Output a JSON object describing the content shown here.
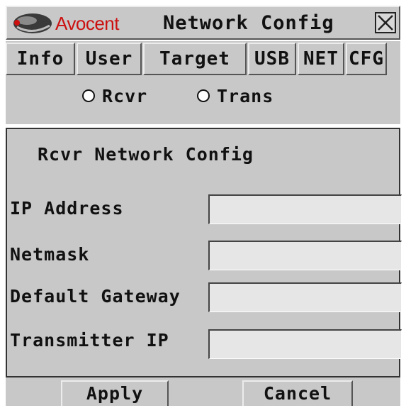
{
  "window": {
    "brand": "Avocent",
    "title": "Network Config"
  },
  "tabs": [
    {
      "label": "Info"
    },
    {
      "label": "User"
    },
    {
      "label": "Target"
    },
    {
      "label": "USB"
    },
    {
      "label": "NET"
    },
    {
      "label": "CFG"
    }
  ],
  "mode": {
    "options": [
      {
        "label": "Rcvr"
      },
      {
        "label": "Trans"
      }
    ]
  },
  "panel": {
    "title": "Rcvr Network Config",
    "fields": [
      {
        "label": "IP Address",
        "value": ""
      },
      {
        "label": "Netmask",
        "value": ""
      },
      {
        "label": "Default Gateway",
        "value": ""
      },
      {
        "label": "Transmitter IP",
        "value": ""
      }
    ]
  },
  "buttons": {
    "apply": "Apply",
    "cancel": "Cancel"
  },
  "colors": {
    "brand": "#cc1010",
    "panel_bg": "#c8c8c8",
    "field_bg": "#e6e6e6"
  }
}
